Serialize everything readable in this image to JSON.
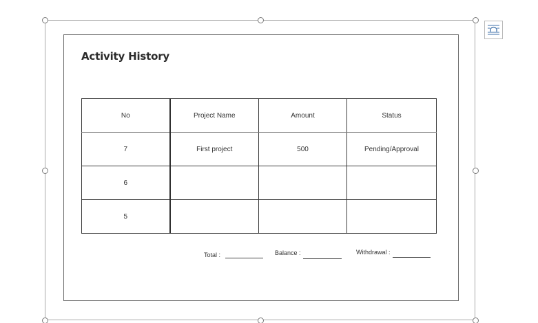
{
  "document": {
    "title": "Activity History",
    "table": {
      "headers": [
        "No",
        "Project Name",
        "Amount",
        "Status"
      ],
      "rows": [
        [
          "7",
          "First project",
          "500",
          "Pending/Approval"
        ],
        [
          "6",
          "",
          "",
          ""
        ],
        [
          "5",
          "",
          "",
          ""
        ]
      ]
    },
    "summary": {
      "total_label": "Total :",
      "balance_label": "Balance :",
      "withdrawal_label": "Withdrawal :"
    }
  },
  "icons": {
    "layout_options": "wrap-text-icon",
    "rotate": "rotate-handle-icon",
    "resize": "resize-handle-icon"
  },
  "colors": {
    "frame_border": "#a8a8a8",
    "table_border": "#3a3a3a",
    "text": "#333333"
  }
}
